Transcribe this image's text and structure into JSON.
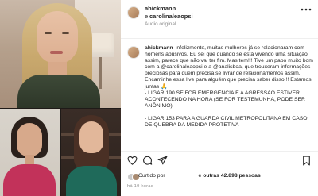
{
  "post": {
    "author": "ahickmann",
    "collab_joiner": "e",
    "collaborator": "carolinaleaopsi",
    "audio": "Áudio original",
    "caption": {
      "author": "ahickmann",
      "lines": [
        "Infelizmente, muitas mulheres já se relacionaram com homens abusivos. Eu sei que quando se está vivendo uma situação assim, parece que não vai ter fim. Mas tem!!! Tive um papo muito bom com a @carolinaleaopsi e a @analisboa, que trouxeram informações preciosas para quem precisa se livrar de relacionamentos assim. Encaminhe essa live para alguém que precisa saber disso!!! Estamos juntas 🙏",
        "- LIGAR 190 SE FOR EMERGÊNCIA E A AGRESSÃO ESTIVER ACONTECENDO NA HORA (SE FOR TESTEMUNHA, PODE SER ANÔNIMO)",
        "- LIGAR 153 PARA A GUARDA CIVIL METROPOLITANA EM CASO DE QUEBRA DA MEDIDA PROTETIVA"
      ]
    },
    "likes_prefix": "Curtido por ",
    "likes_suffix": "e ",
    "likes_count": "outras 42.898 pessoas",
    "time_ago": "há 19 horas"
  },
  "icons": {
    "like": "heart-icon",
    "comment": "comment-icon",
    "share": "share-icon",
    "save": "bookmark-icon",
    "more": "more-icon"
  },
  "colors": {
    "text": "#262626",
    "muted": "#8e8e8e",
    "divider": "#efefef"
  }
}
